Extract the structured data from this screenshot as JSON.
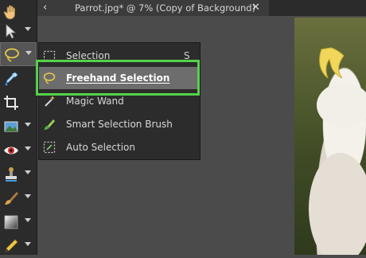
{
  "tab": {
    "back_icon": "chevron-left-icon",
    "title": "Parrot.jpg* @   7% (Copy of Background)",
    "close_icon": "close-icon"
  },
  "toolbar": {
    "tools": [
      {
        "name": "pan",
        "icon": "hand-icon"
      },
      {
        "name": "pick",
        "icon": "arrow-pointer-icon"
      },
      {
        "name": "selection",
        "icon": "lasso-icon",
        "active": true
      },
      {
        "name": "eyedropper",
        "icon": "eyedropper-icon"
      },
      {
        "name": "crop",
        "icon": "crop-icon"
      },
      {
        "name": "straighten",
        "icon": "picture-icon"
      },
      {
        "name": "red-eye",
        "icon": "eye-icon"
      },
      {
        "name": "clone",
        "icon": "clone-stamp-icon"
      },
      {
        "name": "paint-brush",
        "icon": "brush-icon"
      },
      {
        "name": "gradient",
        "icon": "gradient-icon"
      },
      {
        "name": "pencil",
        "icon": "pencil-icon"
      }
    ]
  },
  "selection_menu": {
    "items": [
      {
        "label": "Selection",
        "shortcut": "S",
        "icon": "rectangle-selection-icon"
      },
      {
        "label": "Freehand Selection",
        "shortcut": "",
        "icon": "lasso-icon",
        "selected": true
      },
      {
        "label": "Magic Wand",
        "shortcut": "",
        "icon": "magic-wand-icon"
      },
      {
        "label": "Smart Selection Brush",
        "shortcut": "",
        "icon": "smart-brush-icon"
      },
      {
        "label": "Auto Selection",
        "shortcut": "",
        "icon": "auto-selection-icon"
      }
    ]
  },
  "colors": {
    "highlight": "#55d24a",
    "menu_selected": "#6d6d6d",
    "lasso_yellow": "#e8c84a"
  }
}
